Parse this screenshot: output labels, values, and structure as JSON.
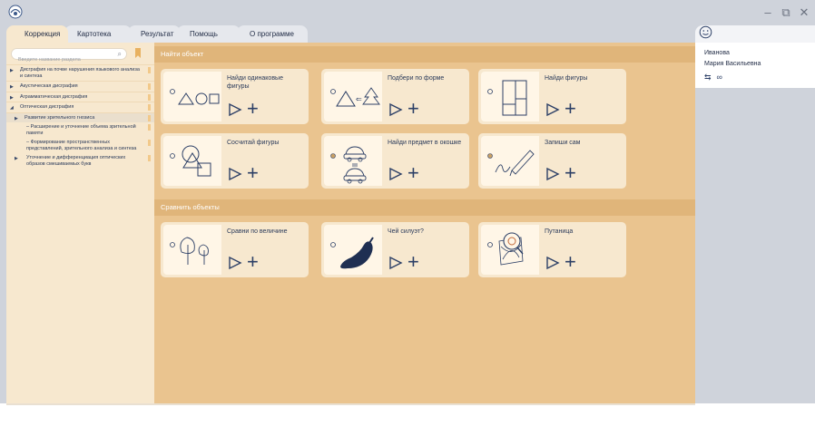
{
  "tabs": [
    {
      "label": "Коррекция",
      "active": true
    },
    {
      "label": "Картотека",
      "active": false
    },
    {
      "label": "Результат",
      "active": false
    },
    {
      "label": "Помощь",
      "active": false
    },
    {
      "label": "О программе",
      "active": false
    }
  ],
  "window": {
    "minimize_icon": "minimize-icon",
    "restore_icon": "restore-icon",
    "close_icon": "close-icon"
  },
  "sidebar": {
    "search_placeholder": "Введите название раздела",
    "items": [
      {
        "label": "Дисграфия на почве нарушения языкового анализа и синтеза",
        "expanded": false
      },
      {
        "label": "Акустическая дисграфия",
        "expanded": false
      },
      {
        "label": "Аграмматическая дисграфия",
        "expanded": false
      },
      {
        "label": "Оптическая дисграфия",
        "expanded": true
      },
      {
        "label": "Развитие зрительного гнозиса",
        "expanded": false
      },
      {
        "label": "– Расширение и уточнение объема зрительной памяти"
      },
      {
        "label": "– Формирование пространственных представлений, зрительного анализа и синтеза"
      },
      {
        "label": "Уточнение и дифференциация оптических образов смешиваемых букв",
        "expanded": false
      }
    ]
  },
  "sections": [
    {
      "title": "Найти объект"
    },
    {
      "title": "Сравнить объекты"
    }
  ],
  "cards": [
    {
      "title": "Найди одинаковые фигуры"
    },
    {
      "title": "Подбери по форме"
    },
    {
      "title": "Найди фигуры"
    },
    {
      "title": "Сосчитай фигуры"
    },
    {
      "title": "Найди предмет в окошке"
    },
    {
      "title": "Запиши сам"
    },
    {
      "title": "Сравни по величине"
    },
    {
      "title": "Чей силуэт?"
    },
    {
      "title": "Путаница"
    }
  ],
  "user": {
    "last_name": "Иванова",
    "full_name": "Мария Васильевна"
  },
  "colors": {
    "accent": "#e0b57a",
    "panel": "#f7e8cf",
    "main_bg": "#eac48f",
    "ink": "#2c3f66"
  }
}
